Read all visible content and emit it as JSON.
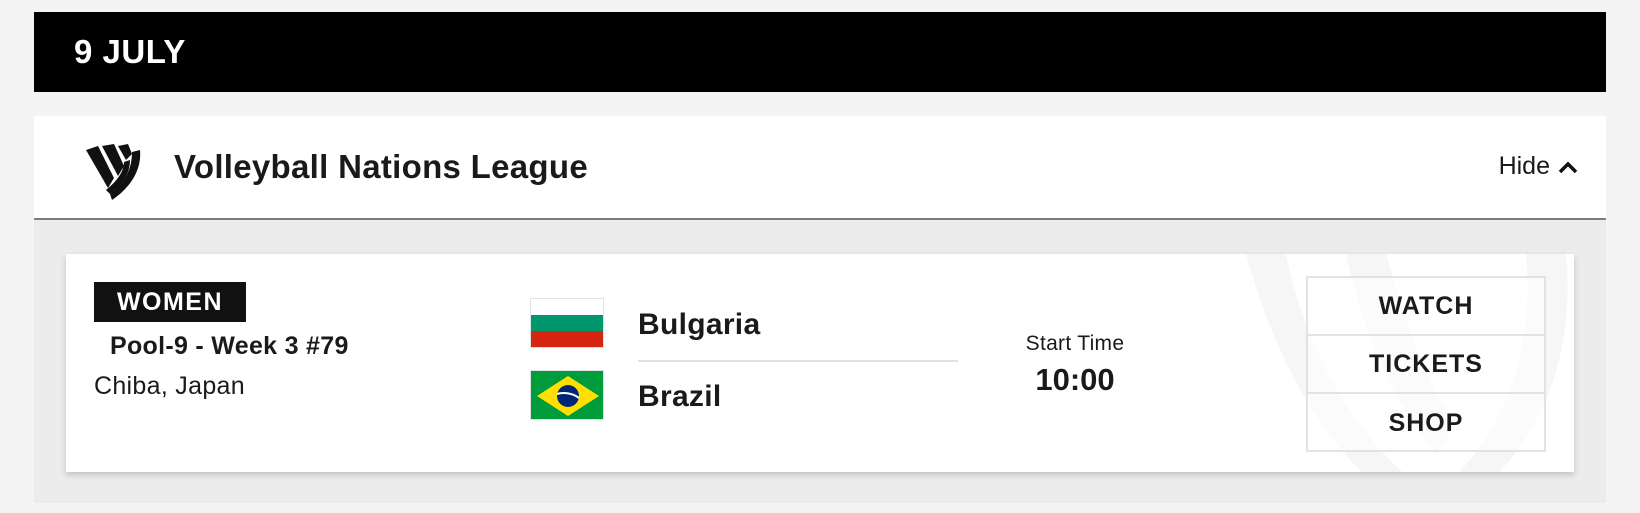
{
  "date_header": {
    "label": "9 JULY"
  },
  "league": {
    "title": "Volleyball Nations League",
    "logo_icon": "vnl-logo-icon",
    "hide_label": "Hide",
    "hide_icon": "chevron-up-icon"
  },
  "match": {
    "gender": "WOMEN",
    "pool": "Pool-9 - Week 3 #79",
    "location": "Chiba, Japan",
    "team_home": {
      "name": "Bulgaria",
      "flag_icon": "bulgaria-flag-icon",
      "flag_colors": [
        "#ffffff",
        "#00966e",
        "#d62612"
      ]
    },
    "team_away": {
      "name": "Brazil",
      "flag_icon": "brazil-flag-icon",
      "flag_colors": [
        "#009c3b",
        "#ffdf00",
        "#002776"
      ]
    },
    "start_label": "Start Time",
    "start_time": "10:00",
    "actions": [
      {
        "label": "WATCH"
      },
      {
        "label": "TICKETS"
      },
      {
        "label": "SHOP"
      }
    ]
  },
  "colors": {
    "header_bg": "#000000",
    "badge_bg": "#111111",
    "page_bg": "#f4f4f4",
    "area_bg": "#ececec"
  }
}
